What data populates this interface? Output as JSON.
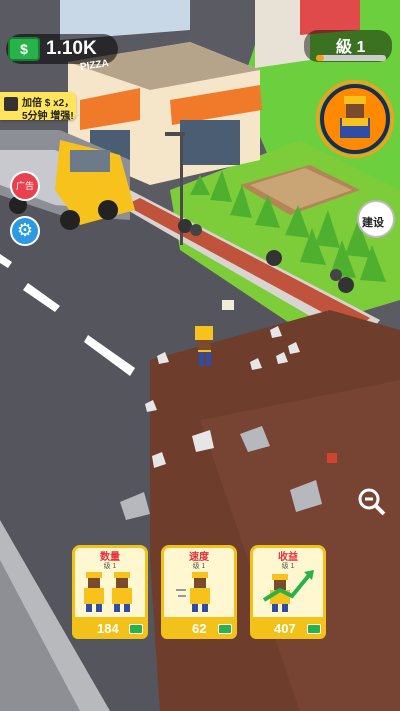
{
  "hud": {
    "money": "1.10K",
    "money_icon": "cash-icon",
    "level": "級 1",
    "level_progress": 0.12,
    "ad_boost": {
      "line1": "加倍 $ x2，",
      "line2": "5分钟 增强!"
    },
    "noad_label": "广告",
    "build_label": "建设"
  },
  "shop": {
    "sign": "PIZZA"
  },
  "cards": [
    {
      "title": "数量",
      "sub": "级 1",
      "value": "184"
    },
    {
      "title": "速度",
      "sub": "级 1",
      "value": "62"
    },
    {
      "title": "收益",
      "sub": "级 1",
      "value": "407"
    }
  ],
  "colors": {
    "accent": "#f2c21b",
    "money": "#27b24a",
    "danger": "#e8414f",
    "info": "#2a9be0"
  }
}
